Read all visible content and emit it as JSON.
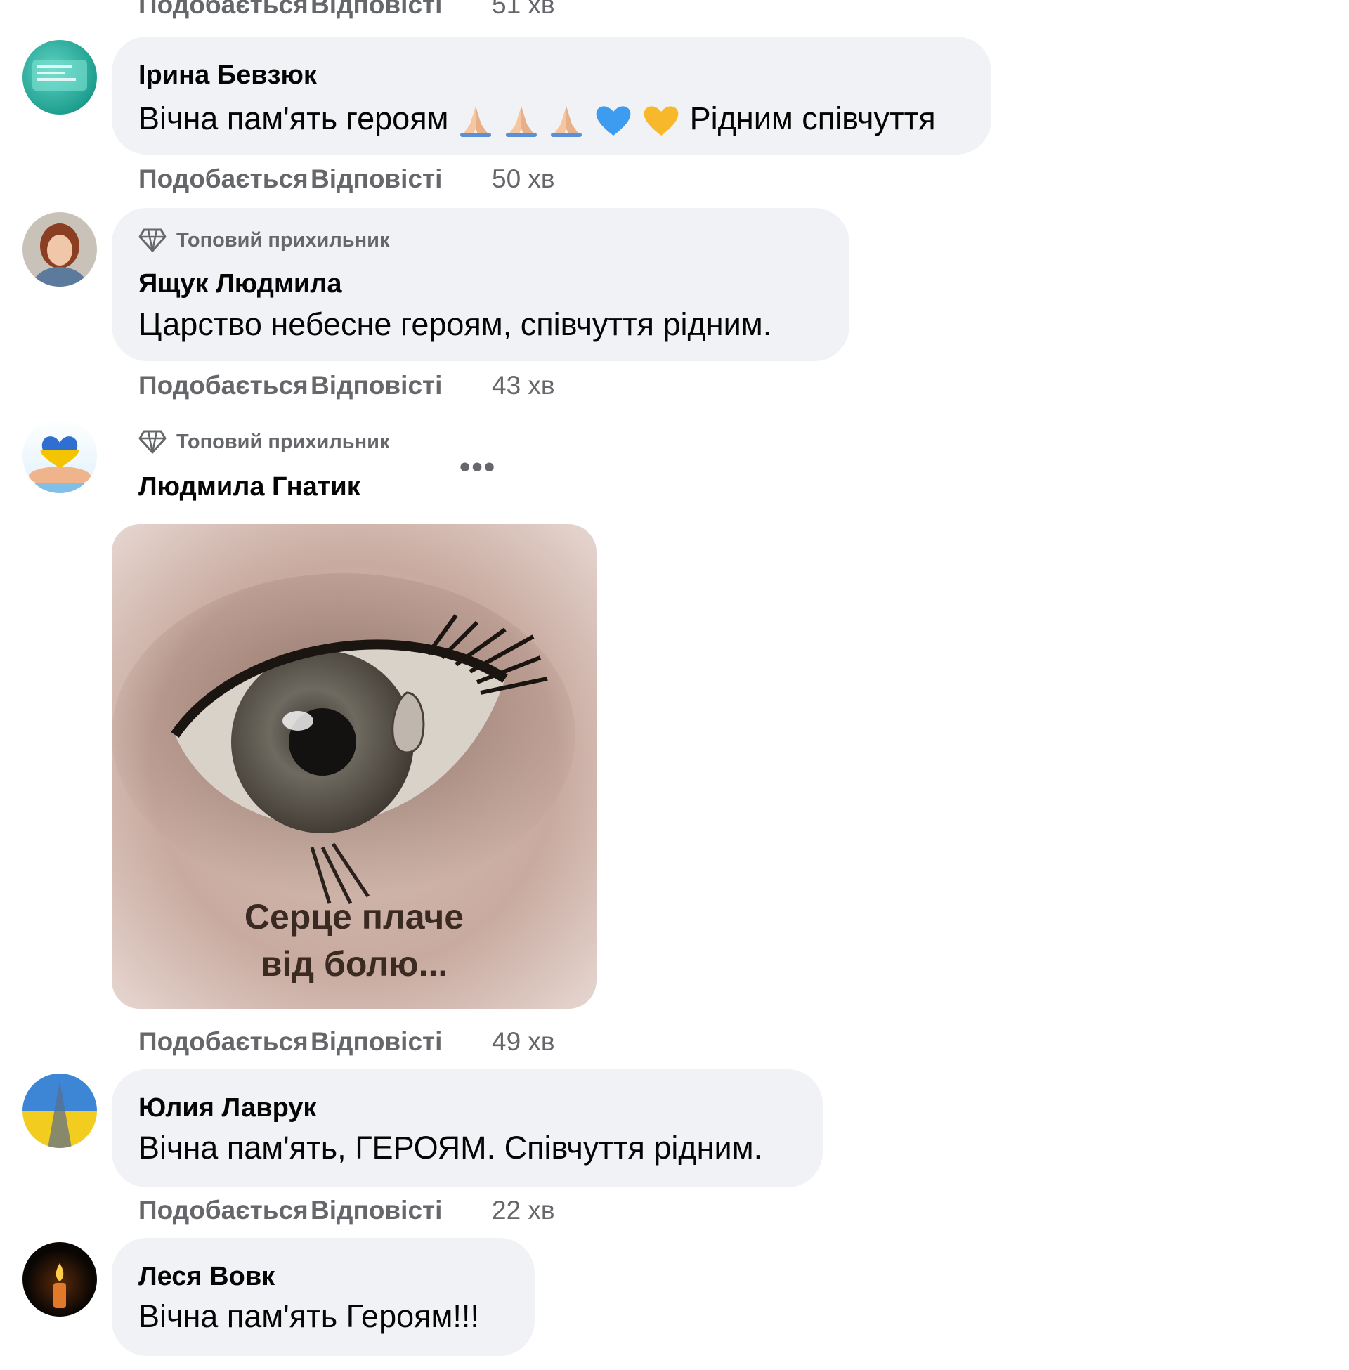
{
  "actions": {
    "like": "Подобається",
    "reply": "Відповісті"
  },
  "top_action_row": {
    "time": "51 хв"
  },
  "badge_label": "Топовий прихильник",
  "comments": [
    {
      "name": "Ірина Бевзюк",
      "text_before": "Вічна пам'ять героям",
      "text_after": "Рідним співчуття",
      "time": "50 хв",
      "emojis": [
        "folded-hands",
        "folded-hands",
        "folded-hands",
        "blue-heart",
        "yellow-heart"
      ]
    },
    {
      "name": "Ящук Людмила",
      "badge": true,
      "text": "Царство небесне героям, співчуття рідним.",
      "time": "43 хв"
    },
    {
      "name": "Людмила Гнатик",
      "badge": true,
      "more": "•••",
      "image_caption_line1": "Серце плаче",
      "image_caption_line2": "від болю...",
      "time": "49 хв"
    },
    {
      "name": "Юлия Лаврук",
      "text": "Вічна пам'ять, ГЕРОЯМ. Співчуття рідним.",
      "time": "22 хв"
    },
    {
      "name": "Леся Вовк",
      "text": "Вічна пам'ять Героям!!!"
    }
  ],
  "colors": {
    "bubble": "#f0f2f5",
    "secondary_text": "#65676b",
    "text": "#050505"
  }
}
